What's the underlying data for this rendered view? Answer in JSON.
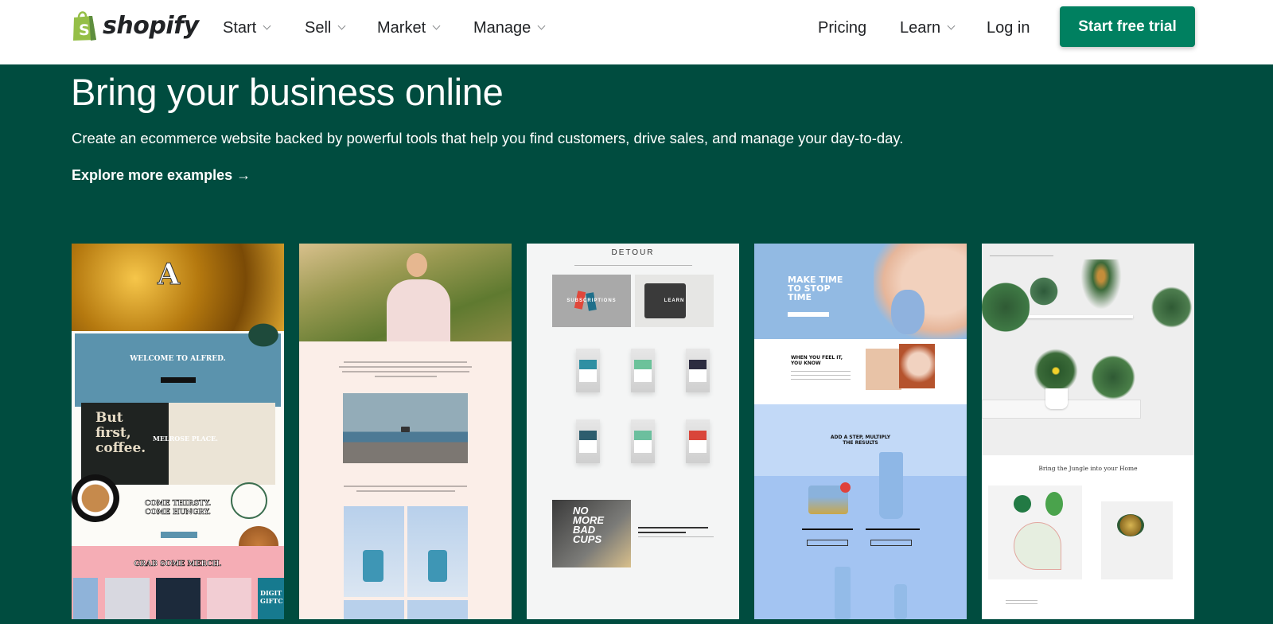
{
  "header": {
    "logo_text": "shopify",
    "nav": [
      {
        "label": "Start",
        "has_dropdown": true
      },
      {
        "label": "Sell",
        "has_dropdown": true
      },
      {
        "label": "Market",
        "has_dropdown": true
      },
      {
        "label": "Manage",
        "has_dropdown": true
      }
    ],
    "right_nav": [
      {
        "label": "Pricing",
        "has_dropdown": false
      },
      {
        "label": "Learn",
        "has_dropdown": true
      },
      {
        "label": "Log in",
        "has_dropdown": false
      }
    ],
    "cta_label": "Start free trial"
  },
  "hero": {
    "title": "Bring your business online",
    "subtitle": "Create an ecommerce website backed by powerful tools that help you find customers, drive sales, and manage your day-to-day.",
    "explore_label": "Explore more examples",
    "explore_arrow": "→"
  },
  "colors": {
    "brand_green": "#004c3f",
    "cta_green": "#008060",
    "logo_green": "#95bf47"
  },
  "examples": [
    {
      "name": "Alfred",
      "texts": {
        "welcome": "WELCOME TO ALFRED.",
        "sign_line1": "But",
        "sign_line2": "first,",
        "sign_line3": "coffee.",
        "location": "MELROSE PLACE.",
        "come1": "COME THIRSTY.",
        "come2": "COME HUNGRY.",
        "merch": "GRAB SOME MERCH.",
        "digital1": "DIGIT",
        "digital2": "GIFTC"
      }
    },
    {
      "name": "Lingerie / apparel store",
      "texts": {}
    },
    {
      "name": "Detour Coffee",
      "texts": {
        "brand": "DETOUR",
        "subscriptions": "SUBSCRIPTIONS",
        "learn": "LEARN",
        "cups1": "NO",
        "cups2": "MORE",
        "cups3": "BAD",
        "cups4": "CUPS"
      }
    },
    {
      "name": "Skincare store",
      "texts": {
        "headline1": "MAKE TIME",
        "headline2": "TO STOP",
        "headline3": "TIME",
        "feel1": "WHEN YOU FEEL IT,",
        "feel2": "YOU KNOW",
        "step1": "ADD A STEP, MULTIPLY",
        "step2": "THE RESULTS"
      }
    },
    {
      "name": "Plant shop",
      "texts": {
        "tagline": "Bring the Jungle into your Home"
      }
    }
  ]
}
